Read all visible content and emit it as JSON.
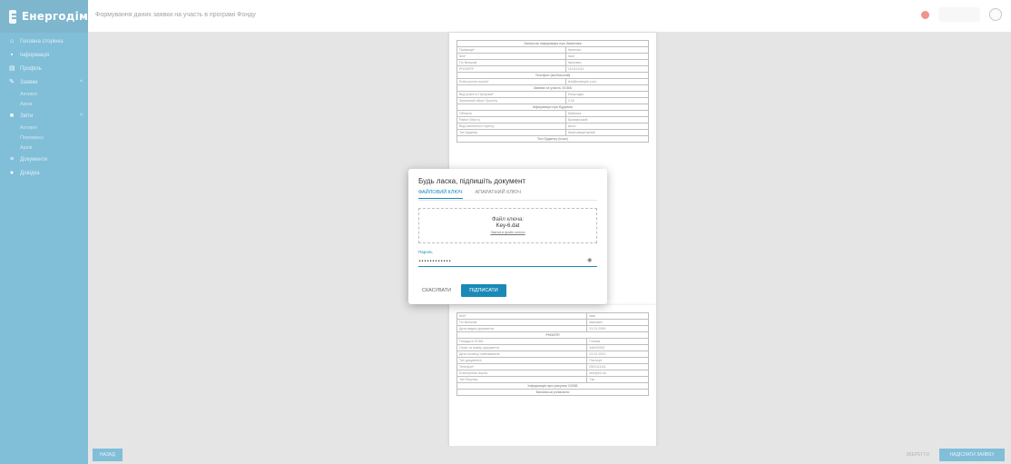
{
  "app": {
    "name": "Енергодім"
  },
  "topbar": {
    "title": "Формування даних заявки на участь в програмі Фонду"
  },
  "sidebar": {
    "items": [
      {
        "icon": "home-icon",
        "label": "Головна сторінка"
      },
      {
        "icon": "info-icon",
        "label": "Інформація"
      },
      {
        "icon": "docs-icon",
        "label": "Профіль"
      },
      {
        "icon": "edit-icon",
        "label": "Заявки",
        "subitems": [
          "Активні",
          "Архів"
        ]
      },
      {
        "icon": "grid-icon",
        "label": "Звіти",
        "subitems": [
          "Активні",
          "Перевірка",
          "Архів"
        ]
      },
      {
        "icon": "list-icon",
        "label": "Документи"
      },
      {
        "icon": "help-icon",
        "label": "Довідка"
      }
    ]
  },
  "document": {
    "page1_rows": [
      [
        "Загальна інформація про Заявника",
        ""
      ],
      [
        "Прізвище*",
        "Іваненко"
      ],
      [
        "Ім'я*",
        "Іван"
      ],
      [
        "По батькові",
        "Іванович"
      ],
      [
        "РНОКПП*",
        "1111111111"
      ],
      [
        "Телефон (мобільний)",
        ""
      ],
      [
        "Електронна пошта*",
        "test@example.com"
      ],
      [
        "Заявка на участь ОСББ",
        ""
      ],
      [
        "Вид участі в Програмі*",
        "Енергодім"
      ],
      [
        "Загальний обсяг Проекту",
        "0,00"
      ],
      [
        "Інформація про Будинок",
        ""
      ],
      [
        "Область",
        "Київська"
      ],
      [
        "Район (Місто)",
        "Броварський"
      ],
      [
        "Вид населеного пункту",
        "місто"
      ],
      [
        "Тип будинку",
        "багатоквартирний"
      ],
      [
        "Тип будинку (інше)",
        ""
      ]
    ],
    "page2_rows": [
      [
        "Ім'я*",
        "Іван"
      ],
      [
        "По батькові",
        "Іванович"
      ],
      [
        "Дата видачі документа",
        "01.01.2000"
      ],
      [
        "РНОКПП",
        ""
      ],
      [
        "Посада в ОСББ",
        "Голова"
      ],
      [
        "Серія та номер документа",
        "АА000000"
      ],
      [
        "Дата початку повноважень",
        "01.01.2021"
      ],
      [
        "Тип документа",
        "Паспорт"
      ],
      [
        "Телефон*",
        "0501111111"
      ],
      [
        "Електронна пошта",
        "test@ex.ua"
      ],
      [
        "Тип Рахунку",
        "Так"
      ],
      [
        "Інформація про рахунок ОСББ",
        ""
      ],
      [
        "Банківські реквізити",
        ""
      ]
    ]
  },
  "bottombar": {
    "back_label": "НАЗАД",
    "save_label": "ЗБЕРЕГТИ",
    "submit_label": "НАДІСЛАТИ ЗАЯВКУ"
  },
  "modal": {
    "title": "Будь ласка, підпишіть документ",
    "tabs": [
      "ФАЙЛОВИЙ КЛЮЧ",
      "АПАРАТНИЙ КЛЮЧ"
    ],
    "dropzone": {
      "label": "Файл ключа:",
      "file_name": "Key-6.dat",
      "change_link": "Змінити файл ключа"
    },
    "password_label": "Пароль",
    "password_value": "••••••••••••",
    "cancel_label": "СКАСУВАТИ",
    "sign_label": "ПІДПИСАТИ"
  },
  "colors": {
    "brand": "#1a89b8",
    "sidebar_bg": "#1a89b8",
    "content_bg": "#cfcfcf"
  }
}
